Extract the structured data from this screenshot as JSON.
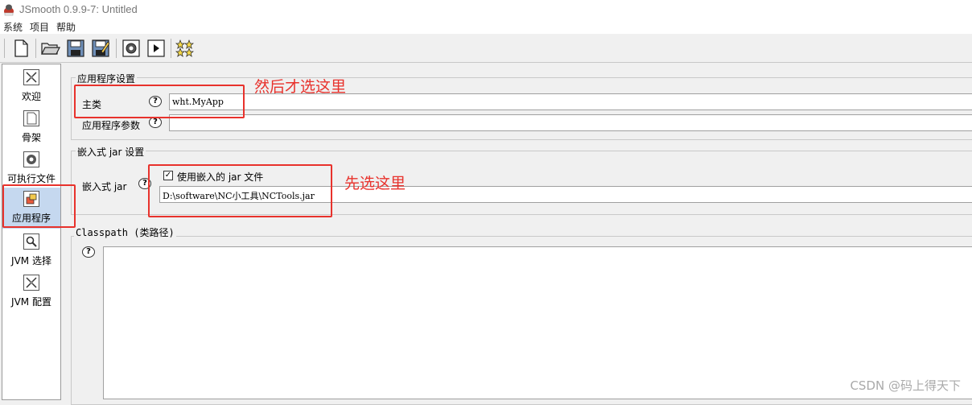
{
  "window": {
    "title": "JSmooth 0.9.9-7: Untitled"
  },
  "menu": [
    "系统",
    "项目",
    "帮助"
  ],
  "toolbar": {
    "buttons": [
      "new-document-icon",
      "open-folder-icon",
      "save-icon",
      "save-as-icon",
      "compile-gear-icon",
      "run-icon",
      "stars-icon"
    ]
  },
  "sidebar": {
    "items": [
      {
        "label": "欢迎",
        "icon": "welcome-icon",
        "selected": false
      },
      {
        "label": "骨架",
        "icon": "skeleton-icon",
        "selected": false
      },
      {
        "label": "可执行文件",
        "icon": "executable-icon",
        "selected": false
      },
      {
        "label": "应用程序",
        "icon": "application-icon",
        "selected": true
      },
      {
        "label": "JVM 选择",
        "icon": "jvm-select-icon",
        "selected": false
      },
      {
        "label": "JVM 配置",
        "icon": "jvm-config-icon",
        "selected": false
      }
    ]
  },
  "app_settings": {
    "group_title": "应用程序设置",
    "main_class_label": "主类",
    "main_class_value": "wht.MyApp",
    "app_args_label": "应用程序参数",
    "app_args_value": ""
  },
  "embedded_jar": {
    "group_title": "嵌入式 jar 设置",
    "label": "嵌入式 jar",
    "checkbox_label": "使用嵌入的 jar 文件",
    "checked": true,
    "check_mark": "✓",
    "jar_path": "D:\\software\\NC小工具\\NCTools.jar"
  },
  "classpath": {
    "group_title": "Classpath (类路径)"
  },
  "help_mark": "?",
  "annotations": {
    "note_main_class": "然后才选这里",
    "note_embedded_jar": "先选这里"
  },
  "watermark": "CSDN @码上得天下",
  "colors": {
    "annotation_red": "#e8322c",
    "selection_blue": "#c5d8ef"
  }
}
